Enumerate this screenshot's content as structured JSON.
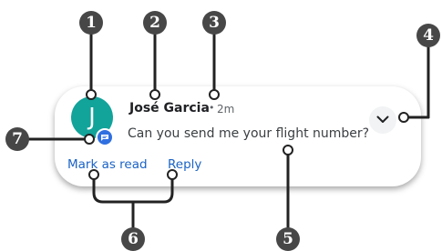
{
  "notification": {
    "avatar_letter": "J",
    "sender": "José Garcia",
    "separator": "•",
    "timestamp": "2m",
    "message": "Can you send me your flight number?",
    "actions": {
      "mark_as_read": "Mark as read",
      "reply": "Reply"
    },
    "avatar_color": "#12a39a",
    "badge_color": "#2f6fe0",
    "action_color": "#1a63c6",
    "badge_icon": "chat-bubble-icon",
    "expand_icon": "chevron-down-icon"
  },
  "callouts": [
    "1",
    "2",
    "3",
    "4",
    "5",
    "6",
    "7"
  ],
  "callout_color": "#474747"
}
